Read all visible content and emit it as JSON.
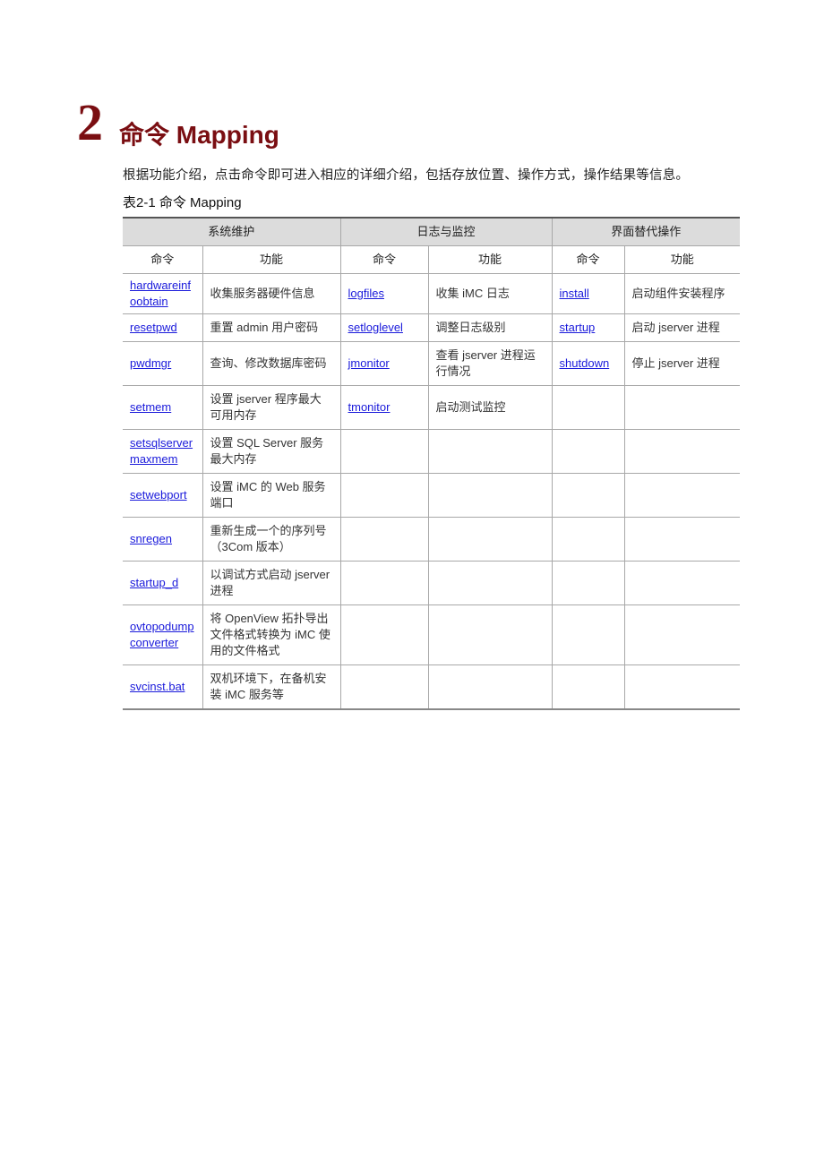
{
  "heading": {
    "number": "2",
    "title": "命令 Mapping"
  },
  "intro": "根据功能介绍，点击命令即可进入相应的详细介绍，包括存放位置、操作方式，操作结果等信息。",
  "table": {
    "caption": "表2-1 命令 Mapping",
    "groups": [
      "系统维护",
      "日志与监控",
      "界面替代操作"
    ],
    "subheaders": [
      "命令",
      "功能",
      "命令",
      "功能",
      "命令",
      "功能"
    ],
    "rows": [
      {
        "sys_cmd": "hardwareinfoobtain",
        "sys_desc": "收集服务器硬件信息",
        "log_cmd": "logfiles",
        "log_desc": "收集 iMC 日志",
        "ui_cmd": "install",
        "ui_desc": "启动组件安装程序"
      },
      {
        "sys_cmd": "resetpwd",
        "sys_desc": "重置 admin 用户密码",
        "log_cmd": "setloglevel",
        "log_desc": "调整日志级别",
        "ui_cmd": "startup",
        "ui_desc": "启动 jserver 进程"
      },
      {
        "sys_cmd": "pwdmgr",
        "sys_desc": "查询、修改数据库密码",
        "log_cmd": "jmonitor",
        "log_desc": "查看 jserver 进程运行情况",
        "ui_cmd": "shutdown",
        "ui_desc": "停止 jserver 进程"
      },
      {
        "sys_cmd": "setmem",
        "sys_desc": "设置 jserver 程序最大可用内存",
        "log_cmd": "tmonitor",
        "log_desc": "启动测试监控",
        "ui_cmd": "",
        "ui_desc": ""
      },
      {
        "sys_cmd": "setsqlservermaxmem",
        "sys_desc": "设置 SQL Server 服务最大内存",
        "log_cmd": "",
        "log_desc": "",
        "ui_cmd": "",
        "ui_desc": ""
      },
      {
        "sys_cmd": "setwebport",
        "sys_desc": "设置 iMC 的 Web 服务端口",
        "log_cmd": "",
        "log_desc": "",
        "ui_cmd": "",
        "ui_desc": ""
      },
      {
        "sys_cmd": "snregen",
        "sys_desc": "重新生成一个的序列号（3Com 版本）",
        "log_cmd": "",
        "log_desc": "",
        "ui_cmd": "",
        "ui_desc": ""
      },
      {
        "sys_cmd": "startup_d",
        "sys_desc": "以调试方式启动 jserver 进程",
        "log_cmd": "",
        "log_desc": "",
        "ui_cmd": "",
        "ui_desc": ""
      },
      {
        "sys_cmd": "ovtopodumpconverter",
        "sys_desc": "将 OpenView 拓扑导出文件格式转换为 iMC 使用的文件格式",
        "log_cmd": "",
        "log_desc": "",
        "ui_cmd": "",
        "ui_desc": ""
      },
      {
        "sys_cmd": "svcinst.bat",
        "sys_desc": "双机环境下，在备机安装 iMC 服务等",
        "log_cmd": "",
        "log_desc": "",
        "ui_cmd": "",
        "ui_desc": ""
      }
    ]
  }
}
